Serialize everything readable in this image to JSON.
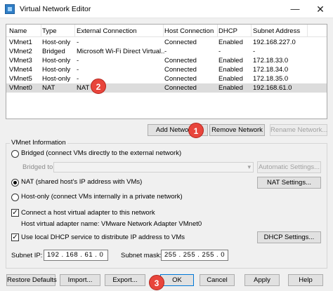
{
  "window": {
    "title": "Virtual Network Editor",
    "minimize_glyph": "—",
    "close_glyph": "✕"
  },
  "table": {
    "columns": [
      "Name",
      "Type",
      "External Connection",
      "Host Connection",
      "DHCP",
      "Subnet Address"
    ],
    "rows": [
      [
        "VMnet1",
        "Host-only",
        "-",
        "Connected",
        "Enabled",
        "192.168.227.0"
      ],
      [
        "VMnet2",
        "Bridged",
        "Microsoft Wi-Fi Direct Virtual...",
        "-",
        "-",
        "-"
      ],
      [
        "VMnet3",
        "Host-only",
        "-",
        "Connected",
        "Enabled",
        "172.18.33.0"
      ],
      [
        "VMnet4",
        "Host-only",
        "-",
        "Connected",
        "Enabled",
        "172.18.34.0"
      ],
      [
        "VMnet5",
        "Host-only",
        "-",
        "Connected",
        "Enabled",
        "172.18.35.0"
      ],
      [
        "VMnet0",
        "NAT",
        "NAT",
        "Connected",
        "Enabled",
        "192.168.61.0"
      ]
    ],
    "selected_row": 5
  },
  "network_buttons": {
    "add": "Add Network...",
    "remove": "Remove Network",
    "rename": "Rename Network..."
  },
  "vmnet_info": {
    "group_label": "VMnet Information",
    "bridged_option": "Bridged (connect VMs directly to the external network)",
    "bridged_to_label": "Bridged to:",
    "automatic_settings": "Automatic Settings...",
    "nat_option": "NAT (shared host's IP address with VMs)",
    "nat_settings": "NAT Settings...",
    "hostonly_option": "Host-only (connect VMs internally in a private network)",
    "connect_adapter": "Connect a host virtual adapter to this network",
    "adapter_name": "Host virtual adapter name: VMware Network Adapter VMnet0",
    "use_dhcp": "Use local DHCP service to distribute IP address to VMs",
    "dhcp_settings": "DHCP Settings...",
    "subnet_ip_label": "Subnet IP:",
    "subnet_ip_value": "192 . 168 . 61 . 0",
    "subnet_mask_label": "Subnet mask:",
    "subnet_mask_value": "255 . 255 . 255 . 0",
    "selected_mode": "nat",
    "connect_adapter_checked": true,
    "use_dhcp_checked": true
  },
  "footer": {
    "restore": "Restore Defaults",
    "import": "Import...",
    "export": "Export...",
    "ok": "OK",
    "cancel": "Cancel",
    "apply": "Apply",
    "help": "Help"
  },
  "callouts": {
    "one": "1",
    "two": "2",
    "three": "3",
    "color": "#e8453c"
  }
}
